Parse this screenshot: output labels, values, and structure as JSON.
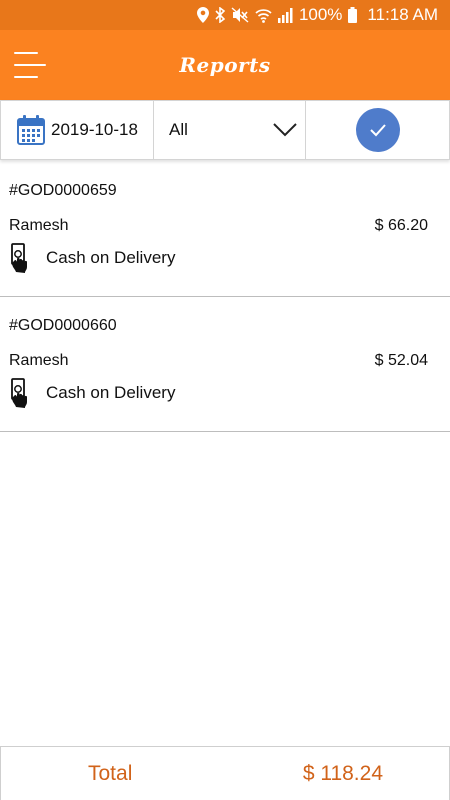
{
  "status_bar": {
    "battery": "100%",
    "time": "11:18 AM",
    "icons": [
      "location-icon",
      "bluetooth-icon",
      "mute-icon",
      "wifi-icon",
      "signal-icon",
      "battery-icon"
    ]
  },
  "app_bar": {
    "title": "Reports",
    "menu_icon": "menu-icon"
  },
  "filters": {
    "date": "2019-10-18",
    "date_icon": "calendar-icon",
    "status_selected": "All",
    "dropdown_icon": "chevron-down-icon",
    "confirm_icon": "check-icon"
  },
  "orders": [
    {
      "id": "#GOD0000659",
      "customer": "Ramesh",
      "amount": "$ 66.20",
      "payment_method": "Cash on Delivery",
      "payment_icon": "cash-hand-icon"
    },
    {
      "id": "#GOD0000660",
      "customer": "Ramesh",
      "amount": "$ 52.04",
      "payment_method": "Cash on Delivery",
      "payment_icon": "cash-hand-icon"
    }
  ],
  "footer": {
    "total_label": "Total",
    "total_amount": "$ 118.24"
  },
  "colors": {
    "status_bar": "#e8771a",
    "app_bar": "#fb8220",
    "confirm_button": "#4f7ccb",
    "total_text": "#d1631a"
  }
}
